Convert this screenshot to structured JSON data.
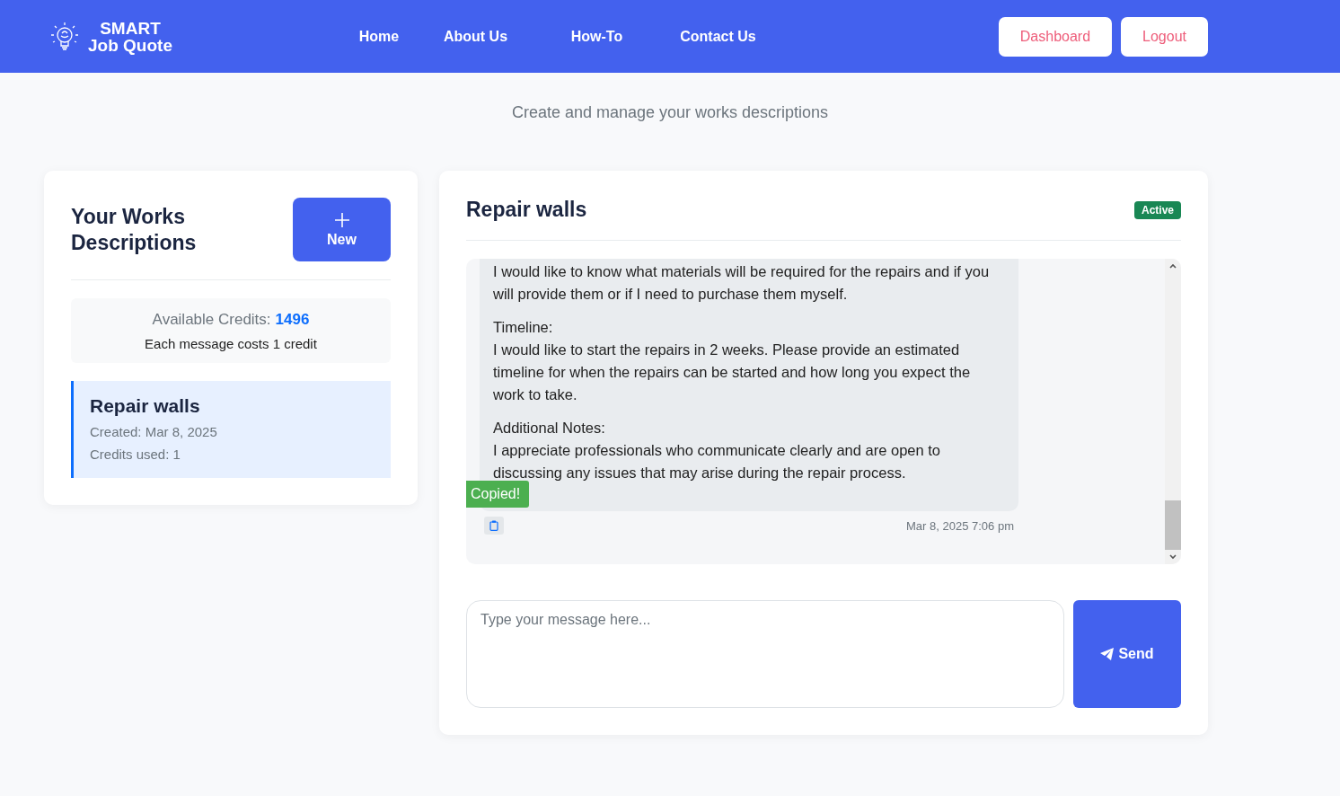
{
  "nav": {
    "logo": [
      "SMART",
      "Job Quote"
    ],
    "links": [
      {
        "label": "Home"
      },
      {
        "label": "About Us"
      },
      {
        "label": "How-To"
      },
      {
        "label": "Contact Us"
      }
    ],
    "buttons": [
      "Dashboard",
      "Logout"
    ]
  },
  "page": {
    "subtitle": "Create and manage your works descriptions"
  },
  "sidebar": {
    "title": "Your Works Descriptions",
    "new_button": "New",
    "credits": {
      "label": "Available Credits:",
      "value": "1496",
      "note": "Each message costs 1 credit"
    },
    "items": [
      {
        "title": "Repair walls",
        "created": "Created: Mar 8, 2025",
        "credits_used": "Credits used: 1",
        "selected": true
      }
    ]
  },
  "chat": {
    "title": "Repair walls",
    "status": "Active",
    "messages": [
      {
        "paragraphs": [
          "I would like to know what materials will be required for the repairs and if you will provide them or if I need to purchase them myself.",
          "Timeline:\nI would like to start the repairs in 2 weeks. Please provide an estimated timeline for when the repairs can be started and how long you expect the work to take.",
          "Additional Notes:\nI appreciate professionals who communicate clearly and are open to discussing any issues that may arise during the repair process."
        ],
        "time": "Mar 8, 2025 7:06 pm",
        "copied": true,
        "tooltip": "Copied!"
      }
    ],
    "input": {
      "placeholder": "Type your message here..."
    },
    "send": "Send"
  }
}
